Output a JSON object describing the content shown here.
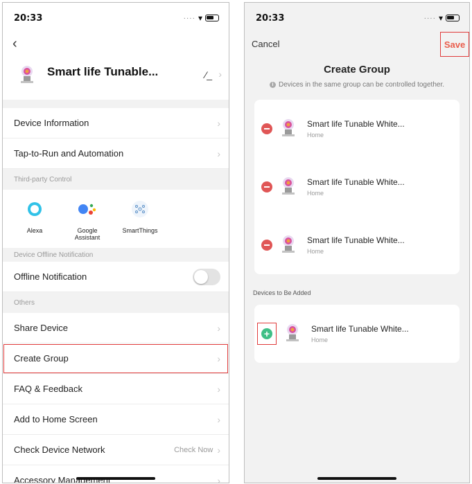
{
  "left": {
    "status": {
      "time": "20:33"
    },
    "header": {
      "title": "Smart life Tunable..."
    },
    "rows_top": [
      {
        "label": "Device Information"
      },
      {
        "label": "Tap-to-Run and Automation"
      }
    ],
    "third_party": {
      "section": "Third-party Control",
      "items": [
        {
          "name": "Alexa"
        },
        {
          "name": "Google\nAssistant"
        },
        {
          "name": "SmartThings"
        }
      ]
    },
    "offline": {
      "section": "Device Offline Notification",
      "label": "Offline Notification",
      "enabled": false
    },
    "others": {
      "section": "Others",
      "share": "Share Device",
      "create_group": "Create Group",
      "faq": "FAQ & Feedback",
      "home_screen": "Add to Home Screen",
      "network": "Check Device Network",
      "network_hint": "Check Now",
      "accessory": "Accessory Management"
    }
  },
  "right": {
    "status": {
      "time": "20:33"
    },
    "nav": {
      "cancel": "Cancel",
      "save": "Save"
    },
    "title": "Create Group",
    "note": "Devices in the same group can be controlled together.",
    "group_devices": [
      {
        "name": "Smart life Tunable White...",
        "room": "Home"
      },
      {
        "name": "Smart life Tunable White...",
        "room": "Home"
      },
      {
        "name": "Smart life Tunable White...",
        "room": "Home"
      }
    ],
    "to_add_label": "Devices to Be Added",
    "to_add_devices": [
      {
        "name": "Smart life Tunable White...",
        "room": "Home"
      }
    ]
  },
  "colors": {
    "save": "#e95c4b",
    "remove": "#e05656",
    "add": "#3fbf86",
    "highlight": "#e03a3a"
  }
}
